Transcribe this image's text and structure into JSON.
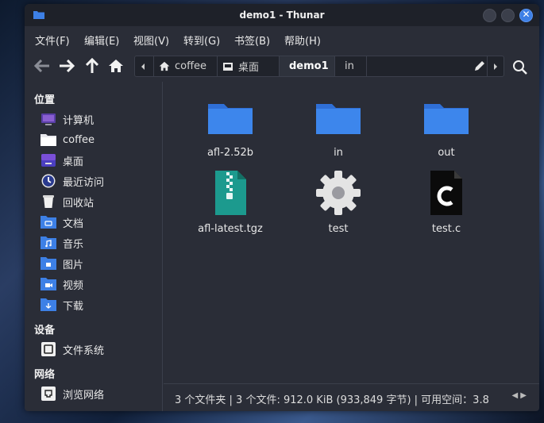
{
  "window": {
    "title": "demo1 - Thunar"
  },
  "menu": [
    "文件(F)",
    "编辑(E)",
    "视图(V)",
    "转到(G)",
    "书签(B)",
    "帮助(H)"
  ],
  "path": {
    "crumbs": [
      "coffee",
      "桌面",
      "demo1",
      "in"
    ],
    "active": "demo1"
  },
  "sidebar": {
    "places_header": "位置",
    "places": [
      "计算机",
      "coffee",
      "桌面",
      "最近访问",
      "回收站",
      "文档",
      "音乐",
      "图片",
      "视频",
      "下载"
    ],
    "devices_header": "设备",
    "devices": [
      "文件系统"
    ],
    "network_header": "网络",
    "network": [
      "浏览网络"
    ]
  },
  "files": [
    {
      "name": "afl-2.52b",
      "icon": "folder-icon"
    },
    {
      "name": "in",
      "icon": "folder-icon"
    },
    {
      "name": "out",
      "icon": "folder-icon"
    },
    {
      "name": "afl-latest.tgz",
      "icon": "archive-icon"
    },
    {
      "name": "test",
      "icon": "executable-gear-icon"
    },
    {
      "name": "test.c",
      "icon": "c-source-icon"
    }
  ],
  "status": "3 个文件夹 | 3 个文件: 912.0 KiB (933,849 字节) | 可用空间：3.8",
  "colors": {
    "accent": "#3d7fe6",
    "window_bg": "#2a2d37",
    "titlebar_bg": "#1e2129",
    "folder": "#3d80e6"
  }
}
